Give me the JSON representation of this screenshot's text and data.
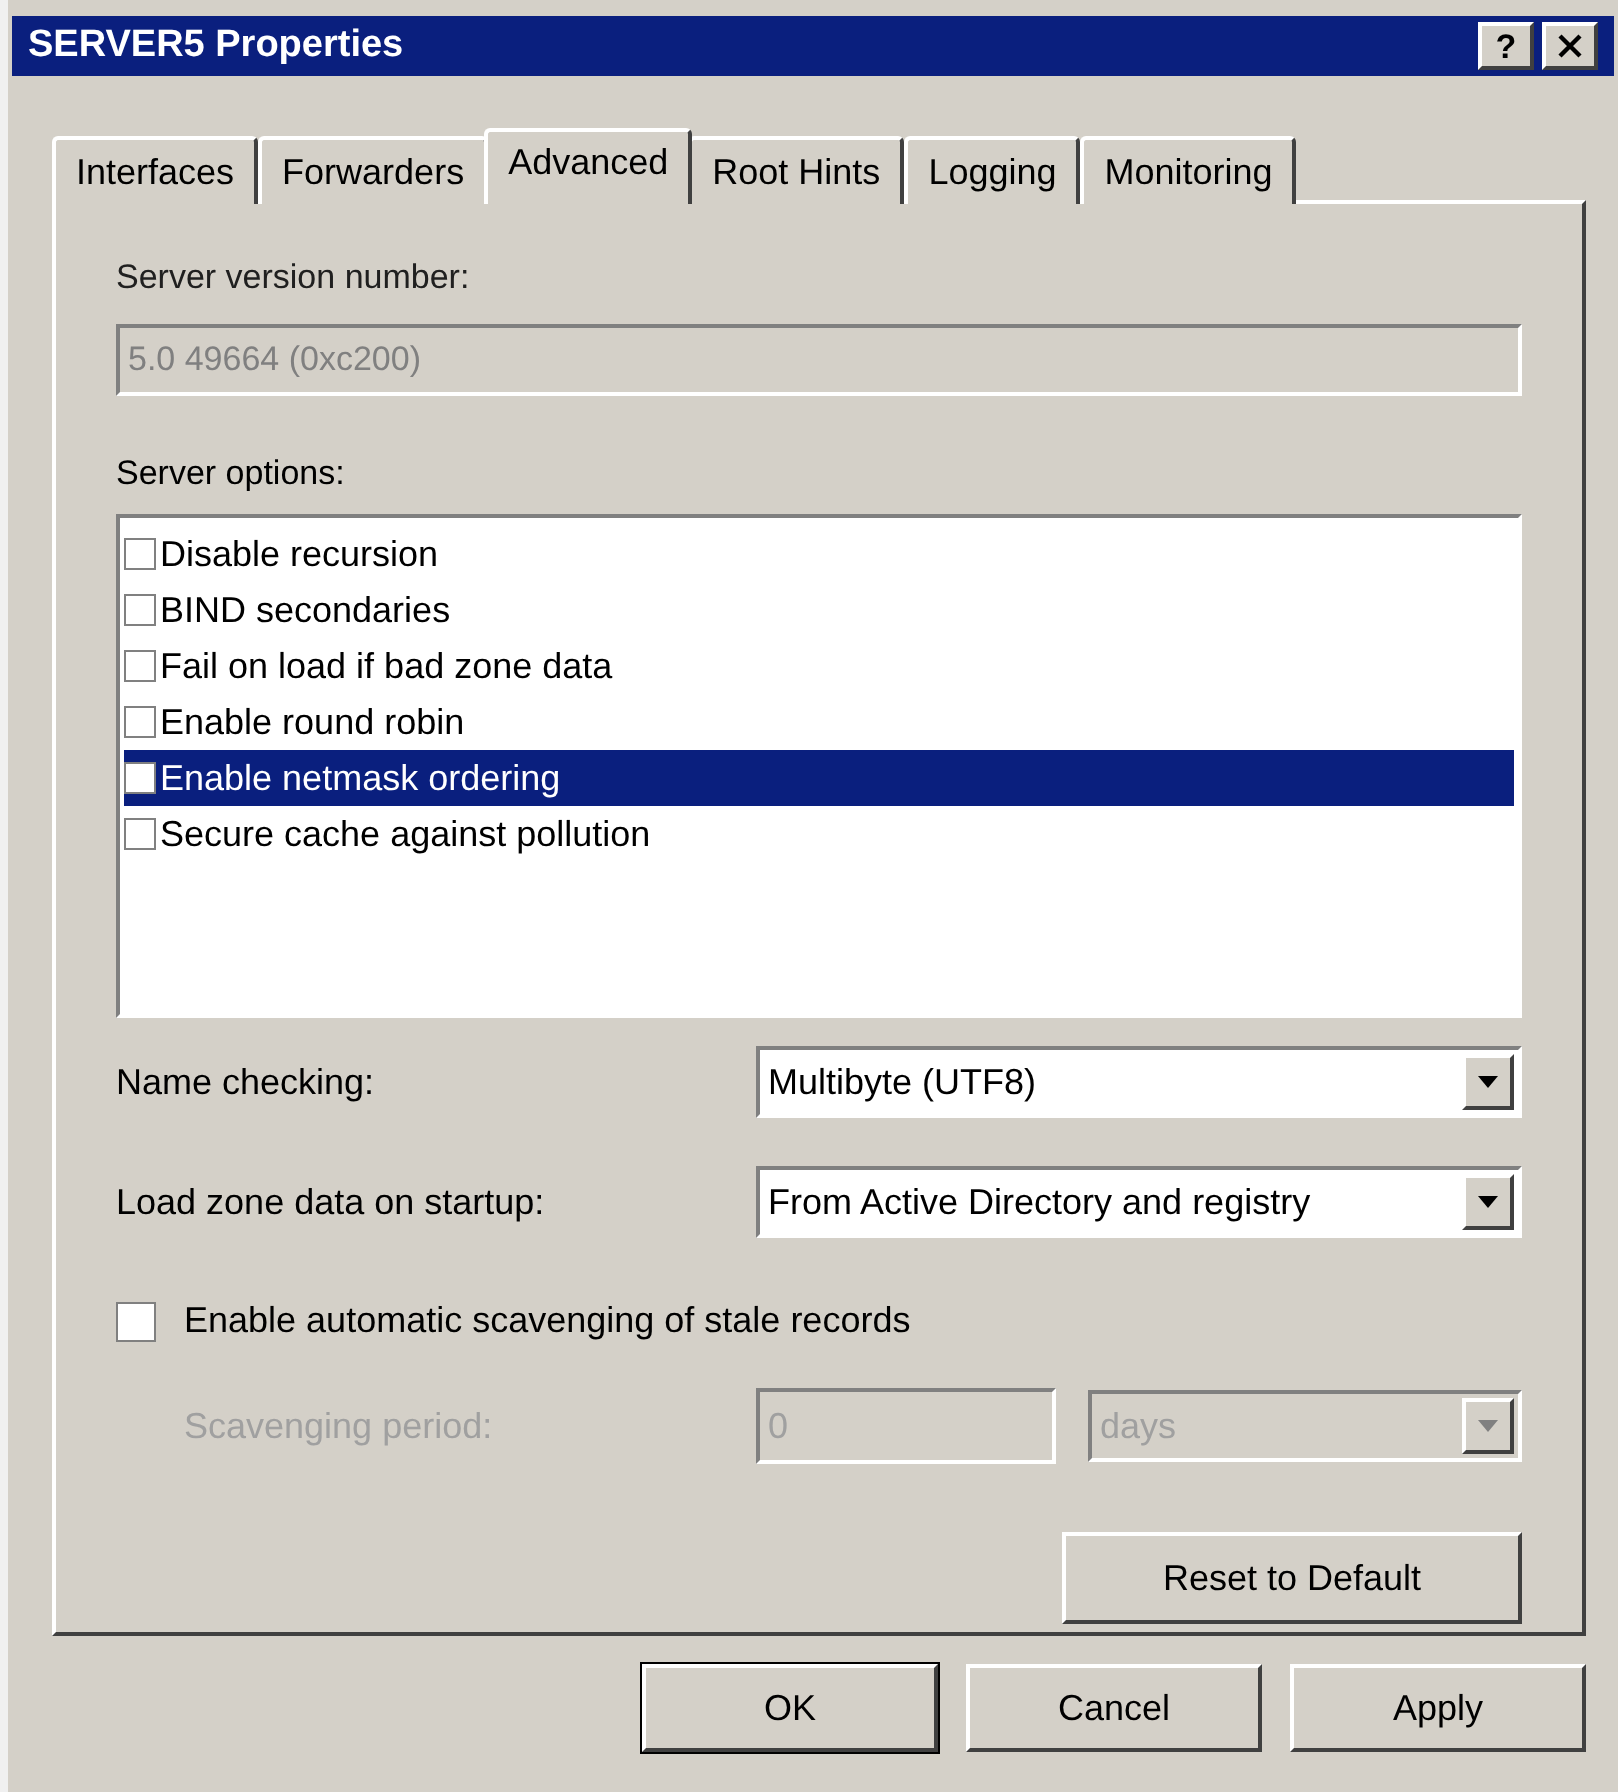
{
  "window": {
    "title": "SERVER5 Properties",
    "help_button": "?"
  },
  "tabs": [
    {
      "label": "Interfaces",
      "selected": false
    },
    {
      "label": "Forwarders",
      "selected": false
    },
    {
      "label": "Advanced",
      "selected": true
    },
    {
      "label": "Root Hints",
      "selected": false
    },
    {
      "label": "Logging",
      "selected": false
    },
    {
      "label": "Monitoring",
      "selected": false
    }
  ],
  "server_version": {
    "label": "Server version number:",
    "value": "5.0 49664 (0xc200)",
    "disabled": true
  },
  "server_options": {
    "label": "Server options:",
    "items": [
      {
        "label": "Disable recursion",
        "checked": false,
        "selected": false
      },
      {
        "label": "BIND secondaries",
        "checked": false,
        "selected": false
      },
      {
        "label": "Fail on load if bad zone data",
        "checked": false,
        "selected": false
      },
      {
        "label": "Enable round robin",
        "checked": false,
        "selected": false
      },
      {
        "label": "Enable netmask ordering",
        "checked": false,
        "selected": true
      },
      {
        "label": "Secure cache against pollution",
        "checked": false,
        "selected": false
      }
    ]
  },
  "name_checking": {
    "label": "Name checking:",
    "value": "Multibyte (UTF8)"
  },
  "load_zone": {
    "label": "Load zone data on startup:",
    "value": "From Active Directory and registry"
  },
  "scavenging": {
    "label": "Enable automatic scavenging of stale records",
    "checked": false
  },
  "scavenging_period": {
    "label": "Scavenging period:",
    "value": "0",
    "unit": "days",
    "disabled": true
  },
  "reset_button": "Reset to Default",
  "buttons": [
    "OK",
    "Cancel",
    "Apply"
  ]
}
